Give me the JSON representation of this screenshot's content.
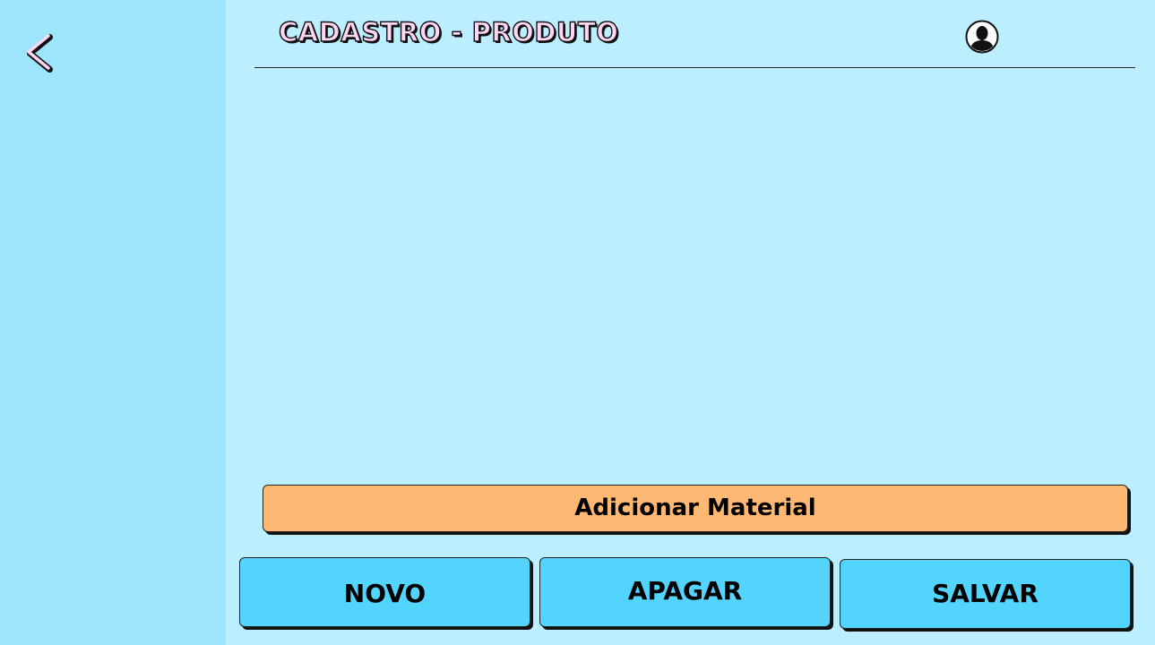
{
  "header": {
    "title": "CADASTRO  - PRODUTO"
  },
  "icons": {
    "back": "chevron-left-icon",
    "user": "user-avatar-icon"
  },
  "buttons": {
    "add_material": "Adicionar Material",
    "novo": "NOVO",
    "apagar": "APAGAR",
    "salvar": "SALVAR"
  },
  "colors": {
    "sidebar_bg": "#9de5fb",
    "main_bg": "#bbeefe",
    "title_fill": "#ffd6f2",
    "add_material_bg": "#ffb874",
    "action_button_bg": "#52d4fc"
  }
}
